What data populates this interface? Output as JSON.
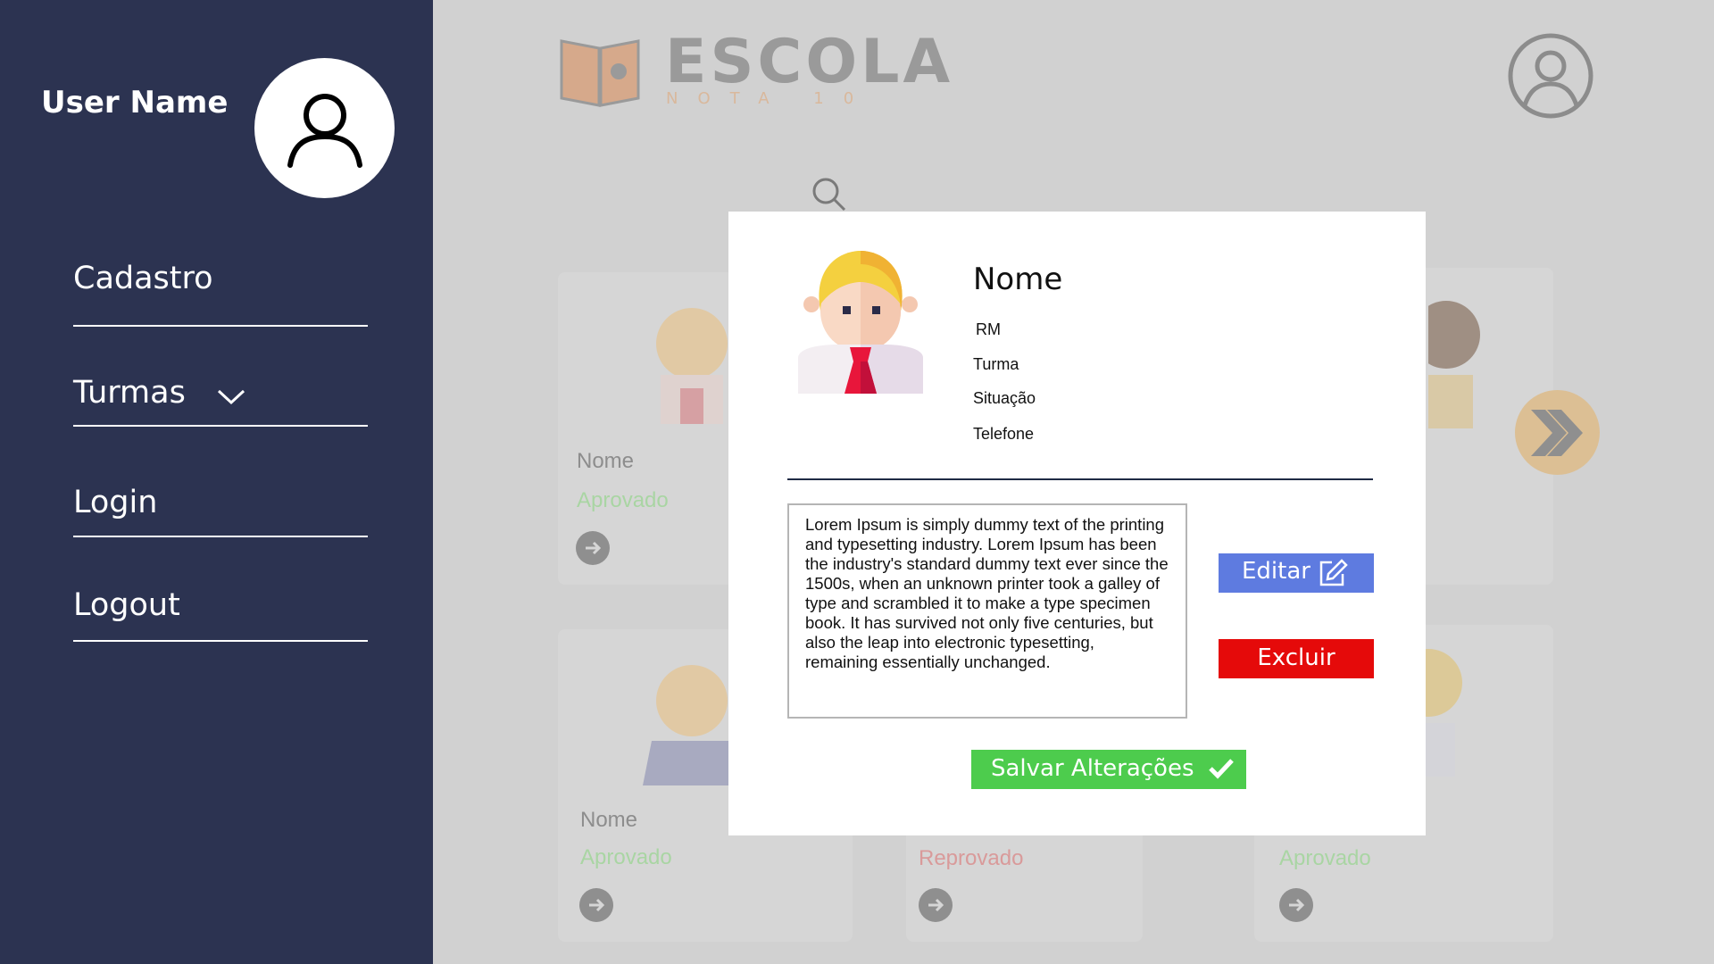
{
  "sidebar": {
    "user_name": "User Name",
    "items": [
      {
        "label": "Cadastro"
      },
      {
        "label": "Turmas"
      },
      {
        "label": "Login"
      },
      {
        "label": "Logout"
      }
    ]
  },
  "header": {
    "logo_title": "ESCOLA",
    "logo_subtitle": "NOTA 10"
  },
  "cards": [
    {
      "name": "Nome",
      "status": "Aprovado"
    },
    {
      "name": "Nome",
      "status": "Aprovado"
    },
    {
      "status": "Reprovado"
    },
    {
      "status": "Aprovado"
    }
  ],
  "modal": {
    "name": "Nome",
    "fields": {
      "rm": "RM",
      "turma": "Turma",
      "situacao": "Situação",
      "telefone": "Telefone"
    },
    "description": "Lorem Ipsum is simply dummy text of the printing and typesetting industry. Lorem Ipsum has been the industry's standard dummy text ever since the 1500s, when an unknown printer took a galley of type and scrambled it to make a type specimen book. It has survived not only five centuries, but also the leap into electronic typesetting, remaining essentially unchanged.",
    "edit_label": "Editar",
    "delete_label": "Excluir",
    "save_label": "Salvar Alterações"
  },
  "colors": {
    "sidebar_bg": "#2c3351",
    "edit": "#5e7be0",
    "delete": "#e50a0a",
    "save": "#4dcc4d",
    "approved": "#a9d5a3",
    "rejected": "#d99a9a"
  },
  "icons": [
    "user-icon",
    "chevron-down-icon",
    "search-icon",
    "profile-icon",
    "double-chevron-right-icon",
    "arrow-right-icon",
    "edit-icon",
    "check-icon",
    "book-logo-icon"
  ]
}
